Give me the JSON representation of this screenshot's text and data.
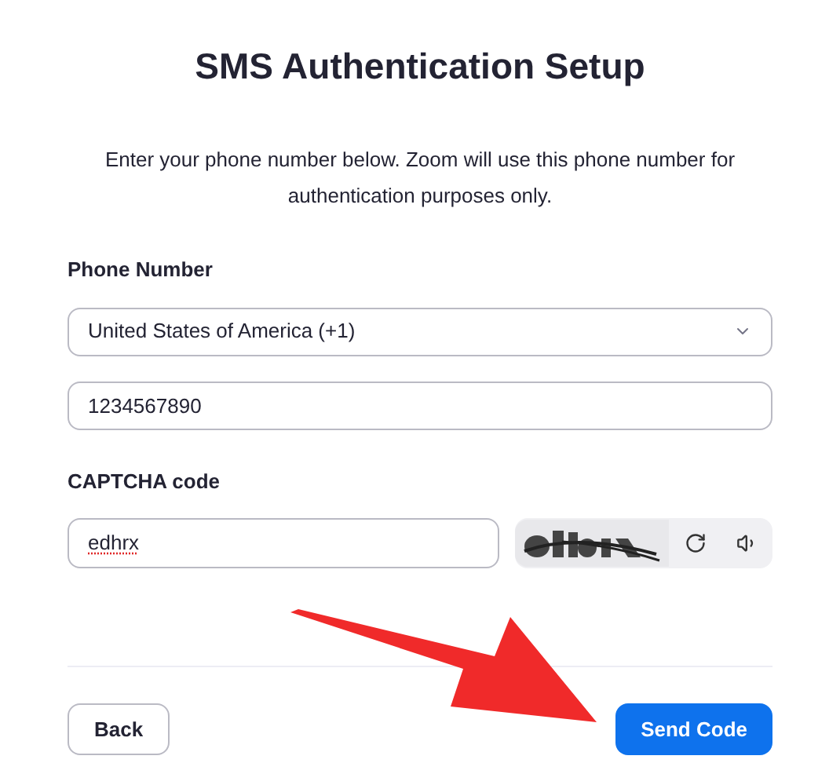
{
  "title": "SMS Authentication Setup",
  "description": "Enter your phone number below. Zoom will use this phone number for authentication purposes only.",
  "phone_label": "Phone Number",
  "country_select": {
    "value": "United States of America (+1)"
  },
  "phone_field": {
    "value": "1234567890"
  },
  "captcha_label": "CAPTCHA code",
  "captcha_field": {
    "value": "edhrx",
    "spellcheck_flag": true
  },
  "buttons": [
    {
      "label": "Back",
      "kind": "secondary"
    },
    {
      "label": "Send Code",
      "kind": "primary"
    }
  ]
}
